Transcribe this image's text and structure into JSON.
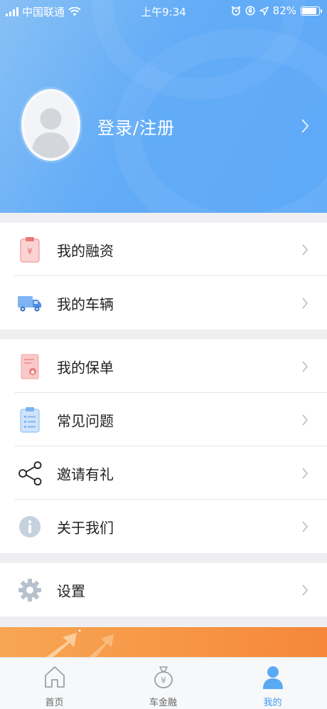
{
  "status_bar": {
    "carrier": "中国联通",
    "time": "上午9:34",
    "battery": "82%",
    "battery_level": 0.82
  },
  "profile": {
    "login_label": "登录/注册",
    "avatar_icon": "default-avatar-icon",
    "chevron_icon": "chevron-right-icon"
  },
  "menu": {
    "group1": [
      {
        "label": "我的融资",
        "icon": "financing-clipboard-icon"
      },
      {
        "label": "我的车辆",
        "icon": "truck-icon"
      }
    ],
    "group2": [
      {
        "label": "我的保单",
        "icon": "policy-document-icon"
      },
      {
        "label": "常见问题",
        "icon": "faq-clipboard-icon"
      },
      {
        "label": "邀请有礼",
        "icon": "share-icon"
      },
      {
        "label": "关于我们",
        "icon": "info-icon"
      }
    ],
    "group3": [
      {
        "label": "设置",
        "icon": "gear-icon"
      }
    ]
  },
  "tabbar": {
    "tabs": [
      {
        "label": "首页",
        "icon": "home-icon",
        "active": false
      },
      {
        "label": "车金融",
        "icon": "money-bag-icon",
        "active": false
      },
      {
        "label": "我的",
        "icon": "user-icon",
        "active": true
      }
    ]
  },
  "colors": {
    "header_blue": "#63acf7",
    "active_tab": "#3e9bf0",
    "banner_orange": "#f79444"
  }
}
